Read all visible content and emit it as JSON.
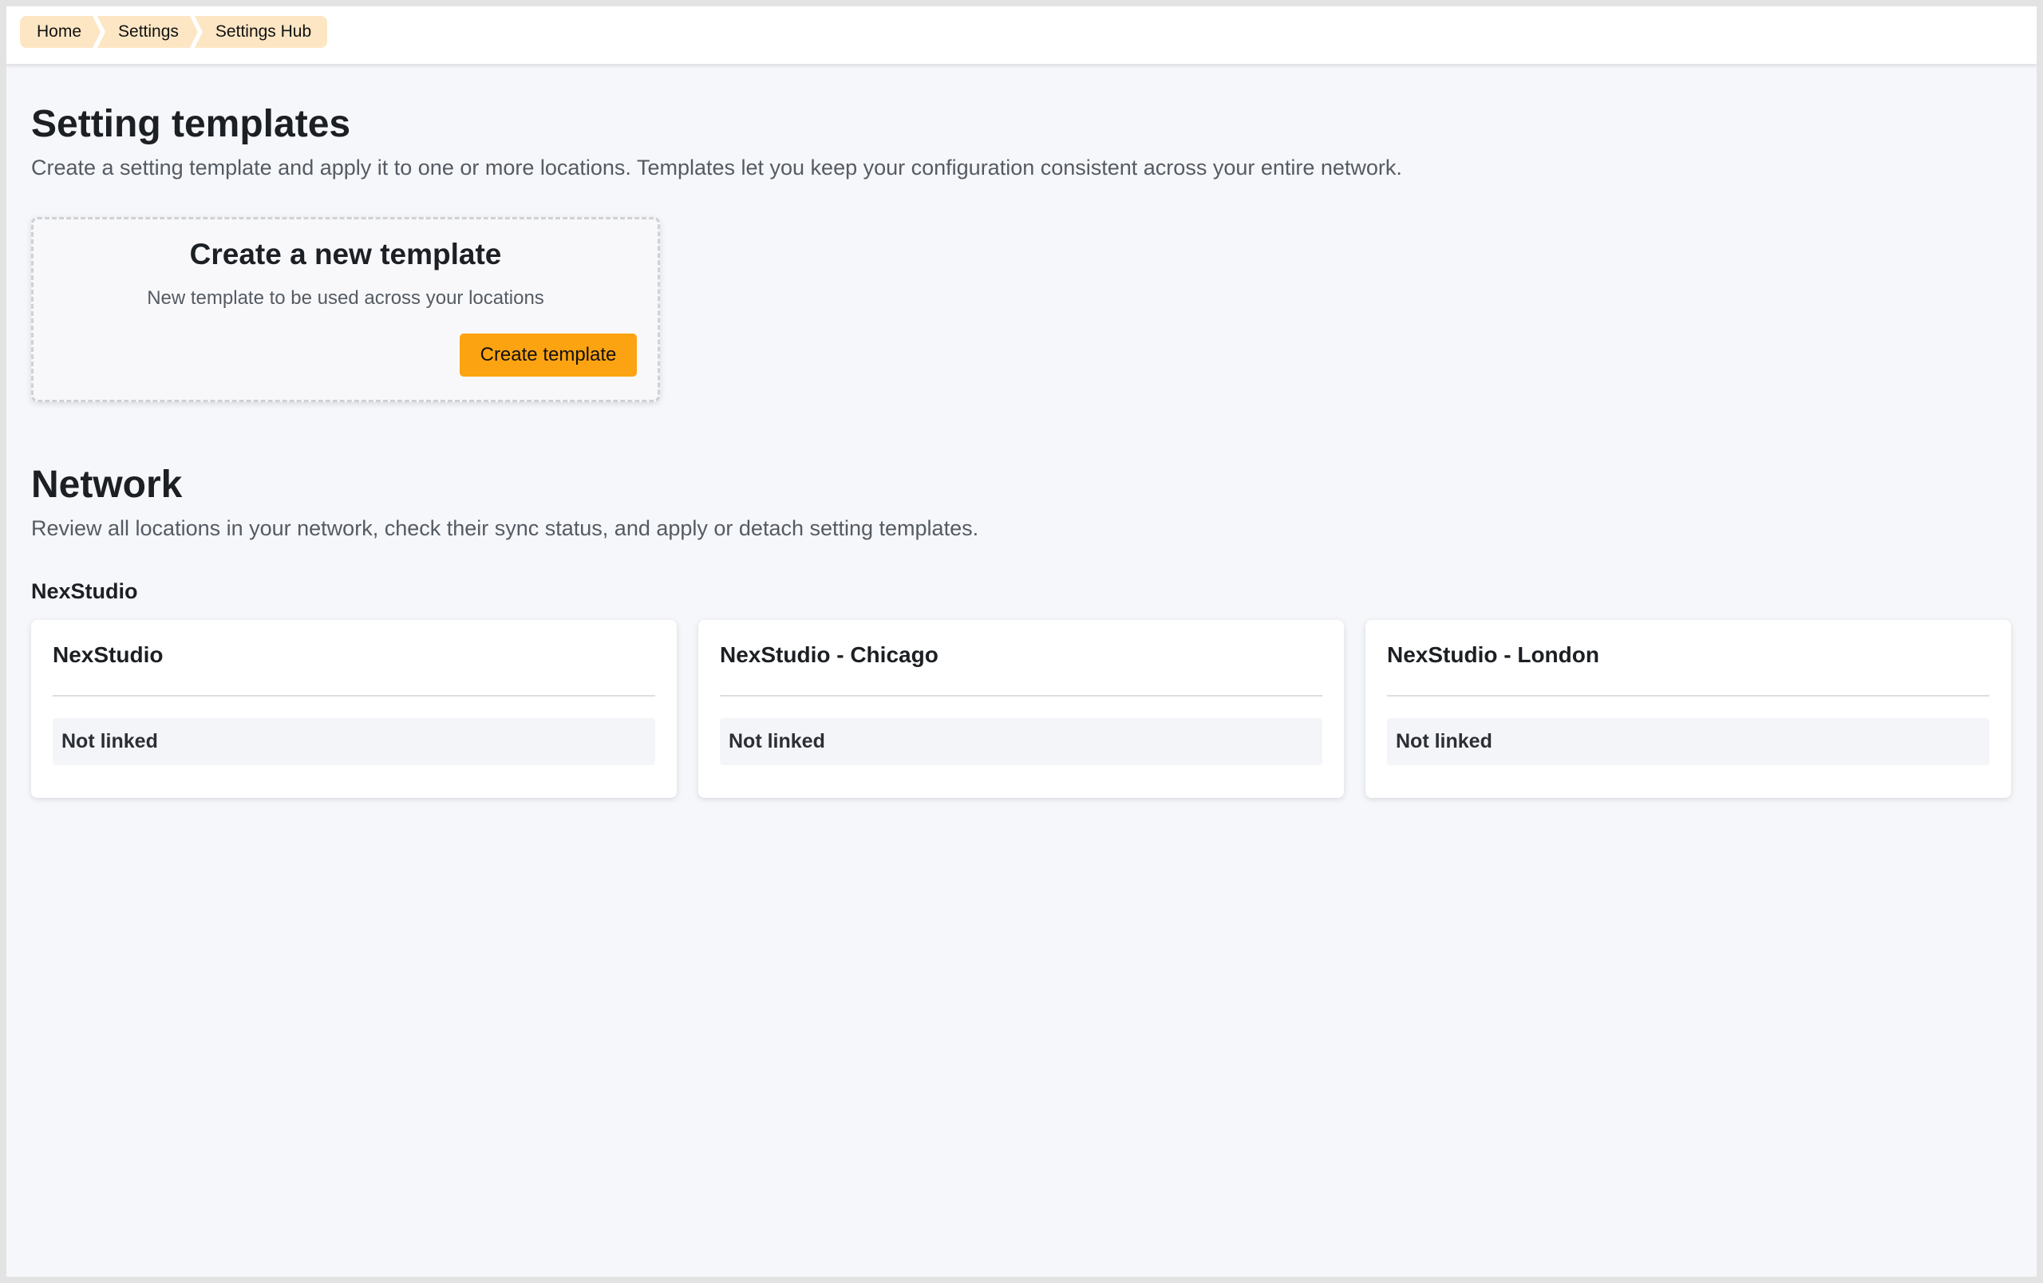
{
  "breadcrumb": [
    "Home",
    "Settings",
    "Settings Hub"
  ],
  "templates": {
    "title": "Setting templates",
    "description": "Create a setting template and apply it to one or more locations. Templates let you keep your configuration consistent across your entire network.",
    "create_card": {
      "title": "Create a new template",
      "description": "New template to be used across your locations",
      "button_label": "Create template"
    }
  },
  "network": {
    "title": "Network",
    "description": "Review all locations in your network, check their sync status, and apply or detach setting templates.",
    "group_name": "NexStudio",
    "locations": [
      {
        "name": "NexStudio",
        "status": "Not linked"
      },
      {
        "name": "NexStudio - Chicago",
        "status": "Not linked"
      },
      {
        "name": "NexStudio - London",
        "status": "Not linked"
      }
    ]
  },
  "colors": {
    "accent": "#fca311",
    "breadcrumb_bg": "#fde6c4",
    "page_bg": "#f6f7fa"
  }
}
